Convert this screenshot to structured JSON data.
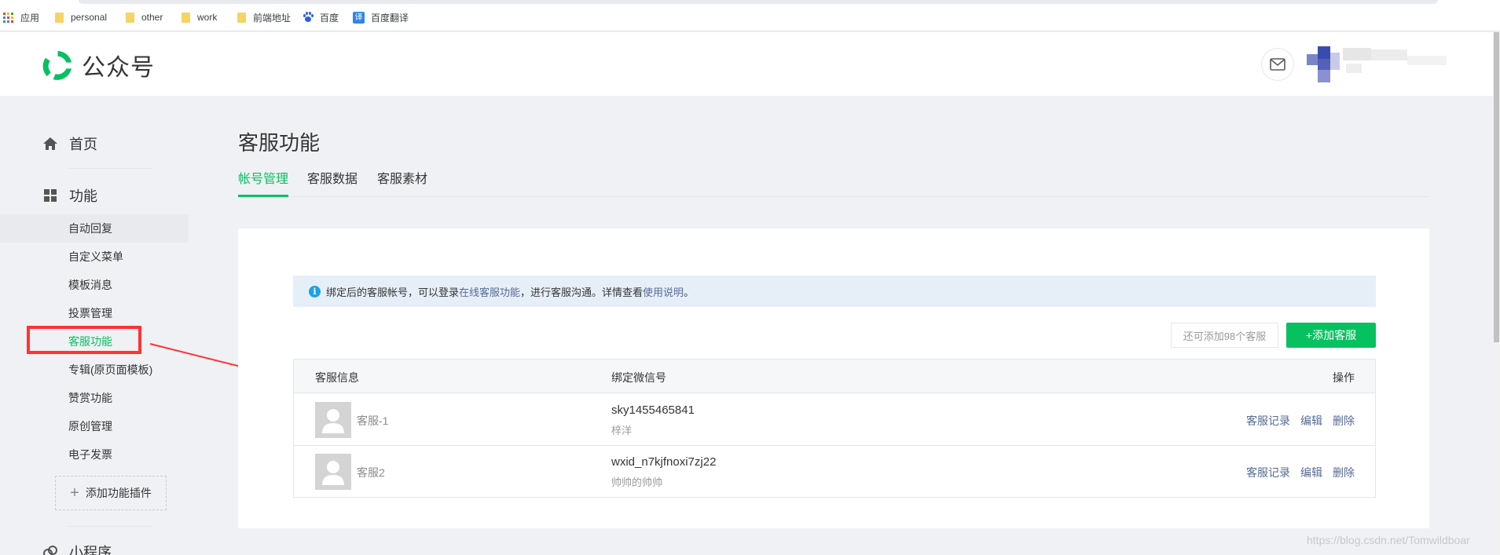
{
  "bookmarks": {
    "apps_label": "应用",
    "folders": [
      "personal",
      "other",
      "work",
      "前端地址"
    ],
    "baidu_label": "百度",
    "fanyi_label": "百度翻译",
    "fanyi_icon_char": "译"
  },
  "header": {
    "brand": "公众号"
  },
  "sidebar": {
    "home_label": "首页",
    "features_label": "功能",
    "sub_items": [
      "自动回复",
      "自定义菜单",
      "模板消息",
      "投票管理",
      "客服功能",
      "专辑(原页面模板)",
      "赞赏功能",
      "原创管理",
      "电子发票"
    ],
    "add_plugin_label": "添加功能插件",
    "miniapp_label": "小程序"
  },
  "page": {
    "title": "客服功能",
    "tabs": [
      "帐号管理",
      "客服数据",
      "客服素材"
    ]
  },
  "notice": {
    "icon_char": "i",
    "text_1": "绑定后的客服帐号，可以登录",
    "link_1": "在线客服功能",
    "text_2": "，进行客服沟通。详情查看",
    "link_2": "使用说明",
    "text_3": "。"
  },
  "toolbar": {
    "quota_text": "还可添加98个客服",
    "add_button": "+添加客服"
  },
  "table": {
    "headers": [
      "客服信息",
      "绑定微信号",
      "操作"
    ],
    "rows": [
      {
        "name": "客服-1",
        "wechat_id": "sky1455465841",
        "nickname": "梓洋",
        "actions": [
          "客服记录",
          "编辑",
          "删除"
        ]
      },
      {
        "name": "客服2",
        "wechat_id": "wxid_n7kjfnoxi7zj22",
        "nickname": "帅帅的帅帅",
        "actions": [
          "客服记录",
          "编辑",
          "删除"
        ]
      }
    ]
  },
  "watermark": "https://blog.csdn.net/Tomwildboar",
  "colors": {
    "accent": "#07c160",
    "link": "#576b95",
    "annotation_red": "#ff3333",
    "notice_bg": "#e6eef8"
  }
}
